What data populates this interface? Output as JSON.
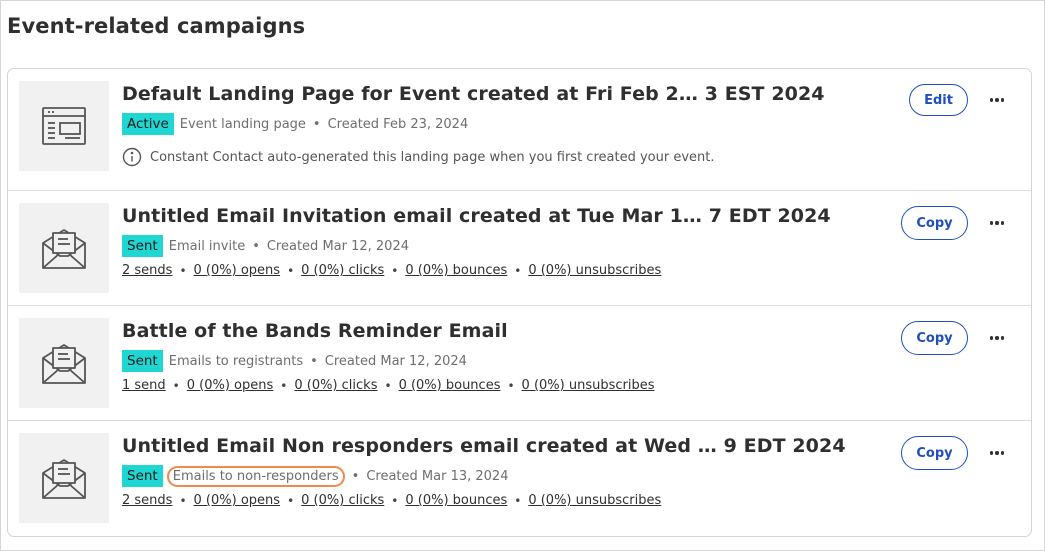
{
  "heading": "Event-related campaigns",
  "campaigns": [
    {
      "title": "Default Landing Page for Event created at Fri Feb 2…  3 EST 2024",
      "status": "Active",
      "type": "Event landing page",
      "created": "Created Feb 23, 2024",
      "note": "Constant Contact auto-generated this landing page when you first created your event.",
      "action_label": "Edit",
      "icon": "landing-page-icon"
    },
    {
      "title": "Untitled Email Invitation email created at Tue Mar 1…  7 EDT 2024",
      "status": "Sent",
      "type": "Email invite",
      "created": "Created Mar 12, 2024",
      "stats": [
        "2 sends",
        "0 (0%) opens",
        "0 (0%) clicks",
        "0 (0%) bounces",
        "0 (0%) unsubscribes"
      ],
      "action_label": "Copy",
      "icon": "email-envelope-icon"
    },
    {
      "title": "Battle of the Bands Reminder Email",
      "status": "Sent",
      "type": "Emails to registrants",
      "created": "Created Mar 12, 2024",
      "stats": [
        "1 send",
        "0 (0%) opens",
        "0 (0%) clicks",
        "0 (0%) bounces",
        "0 (0%) unsubscribes"
      ],
      "action_label": "Copy",
      "icon": "email-envelope-icon"
    },
    {
      "title": "Untitled Email Non responders email created at Wed …  9 EDT 2024",
      "status": "Sent",
      "type": "Emails to non-responders",
      "created": "Created Mar 13, 2024",
      "stats": [
        "2 sends",
        "0 (0%) opens",
        "0 (0%) clicks",
        "0 (0%) bounces",
        "0 (0%) unsubscribes"
      ],
      "action_label": "Copy",
      "icon": "email-envelope-icon",
      "highlight": "#ee8a4c"
    }
  ],
  "colors": {
    "badge": "#1fd6d2",
    "button": "#1f4fbf",
    "highlight": "#ee8a4c"
  }
}
